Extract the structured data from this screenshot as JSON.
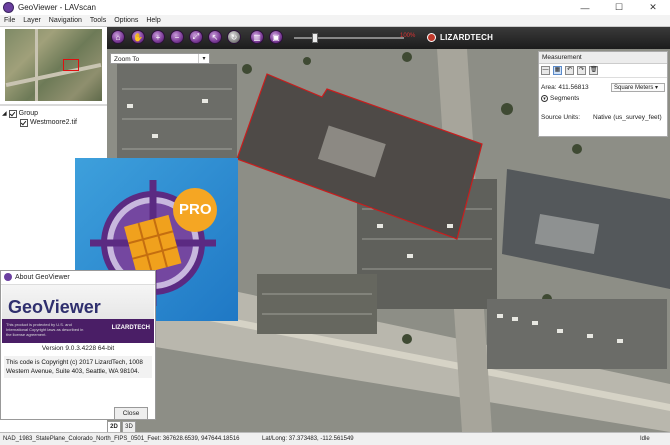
{
  "window": {
    "title": "GeoViewer - LAVscan",
    "controls": [
      "—",
      "☐",
      "✕"
    ]
  },
  "menu": [
    "File",
    "Layer",
    "Navigation",
    "Tools",
    "Options",
    "Help"
  ],
  "layers": {
    "group_label": "Group",
    "items": [
      {
        "label": "Westmoore2.tif"
      }
    ]
  },
  "toolbar": {
    "buttons": [
      "home-icon",
      "hand-pan-icon",
      "zoom-in-icon",
      "zoom-out-icon",
      "zoom-extent-icon",
      "pointer-icon",
      "refresh-icon",
      "ruler-icon",
      "crop-icon"
    ],
    "slider_value": "100%",
    "brand": "LIZARDTECH"
  },
  "zoom_to": {
    "placeholder": "Zoom To"
  },
  "measurement": {
    "title": "Measurement",
    "area_label": "Area: 411.56813",
    "unit": "Square Meters",
    "segments_label": "Segments",
    "source_units_label": "Source Units:",
    "source_units_value": "Native (us_survey_feet)"
  },
  "pro_badge": {
    "text": "PRO",
    "colors": {
      "bg": "#2b8ad3",
      "ring": "#5b2a82",
      "orange": "#f5a623"
    }
  },
  "about": {
    "title": "About GeoViewer",
    "logo_text": "GeoViewer",
    "tagline": "This product is protected by U.S. and International Copyright laws as described in the license agreement.",
    "brand": "LIZARDTECH",
    "version": "Version 9.0.3.4228 64-bit",
    "copyright": "This code is Copyright (c) 2017 LizardTech, 1008 Western Avenue, Suite 403, Seattle, WA 98104.",
    "close_label": "Close"
  },
  "view_tabs": [
    "2D",
    "3D"
  ],
  "status": {
    "projection": "NAD_1983_StatePlane_Colorado_North_FIPS_0501_Feet: 367628.6539, 947644.18516",
    "latlong": "Lat/Long: 37.373483, -112.561549",
    "state": "Idle"
  }
}
